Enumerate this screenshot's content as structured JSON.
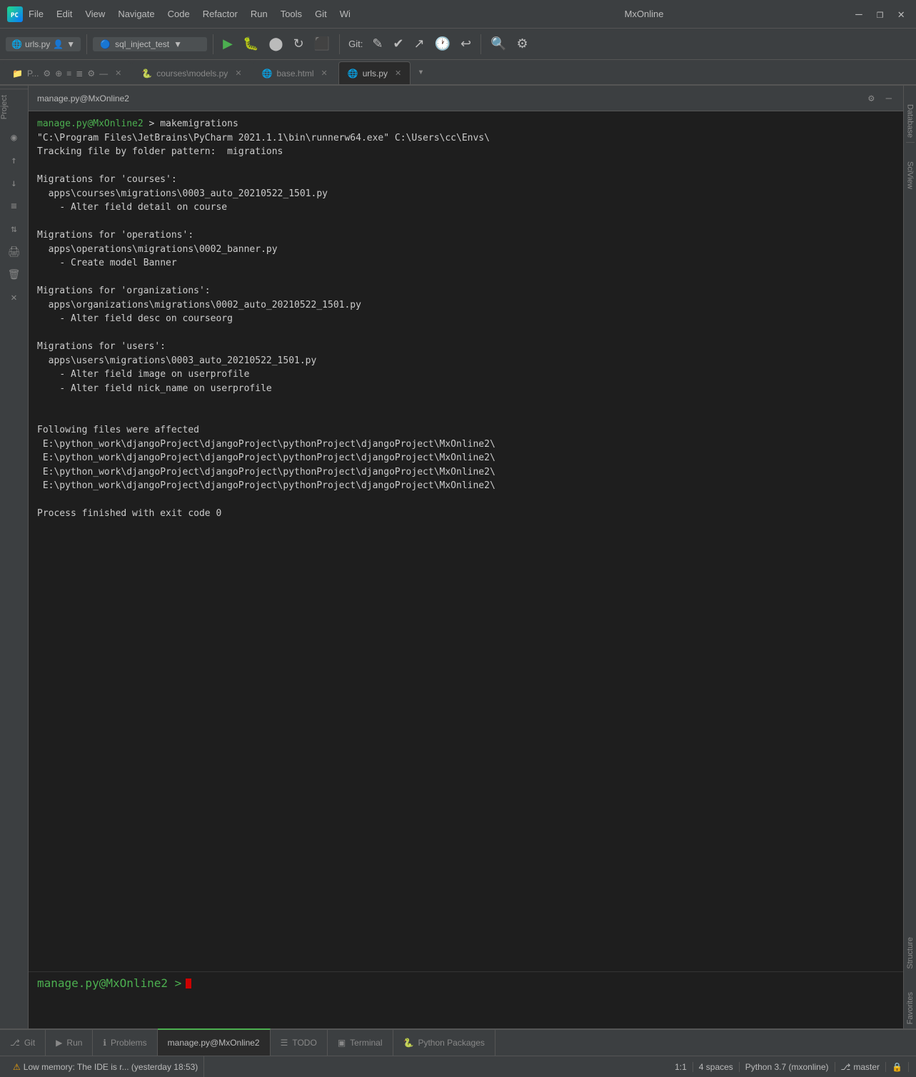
{
  "titlebar": {
    "menu_items": [
      "File",
      "Edit",
      "View",
      "Navigate",
      "Code",
      "Refactor",
      "Run",
      "Tools",
      "Git",
      "Wi"
    ],
    "title": "MxOnline",
    "controls": [
      "—",
      "❐",
      "✕"
    ]
  },
  "toolbar": {
    "file_label": "urls.py",
    "branch_label": "sql_inject_test",
    "git_label": "Git:",
    "search_icon": "🔍",
    "settings_icon": "⚙"
  },
  "tabs": [
    {
      "label": "P...",
      "icon": "📄",
      "active": false,
      "closable": false
    },
    {
      "label": "courses\\models.py",
      "icon": "🐍",
      "active": false,
      "closable": true
    },
    {
      "label": "base.html",
      "icon": "🌐",
      "active": false,
      "closable": true
    },
    {
      "label": "urls.py",
      "icon": "🌐",
      "active": true,
      "closable": true
    }
  ],
  "terminal": {
    "title": "manage.py@MxOnline2",
    "prompt": "manage.py@MxOnline2",
    "command": "makemigrations",
    "output": [
      "\"C:\\Program Files\\JetBrains\\PyCharm 2021.1.1\\bin\\runnerw64.exe\" C:\\Users\\cc\\Envs\\",
      "Tracking file by folder pattern:  migrations",
      "",
      "Migrations for 'courses':",
      "  apps\\courses\\migrations\\0003_auto_20210522_1501.py",
      "    - Alter field detail on course",
      "",
      "Migrations for 'operations':",
      "  apps\\operations\\migrations\\0002_banner.py",
      "    - Create model Banner",
      "",
      "Migrations for 'organizations':",
      "  apps\\organizations\\migrations\\0002_auto_20210522_1501.py",
      "    - Alter field desc on courseorg",
      "",
      "Migrations for 'users':",
      "  apps\\users\\migrations\\0003_auto_20210522_1501.py",
      "    - Alter field image on userprofile",
      "    - Alter field nick_name on userprofile",
      "",
      "",
      "Following files were affected",
      " E:\\python_work\\djangoProject\\djangoProject\\pythonProject\\djangoProject\\MxOnline2\\",
      " E:\\python_work\\djangoProject\\djangoProject\\pythonProject\\djangoProject\\MxOnline2\\",
      " E:\\python_work\\djangoProject\\djangoProject\\pythonProject\\djangoProject\\MxOnline2\\",
      " E:\\python_work\\djangoProject\\djangoProject\\pythonProject\\djangoProject\\MxOnline2\\",
      "",
      "Process finished with exit code 0"
    ],
    "input_prompt": "manage.py@MxOnline2 >"
  },
  "bottom_tabs": [
    {
      "label": "Git",
      "icon": "⎇",
      "active": false
    },
    {
      "label": "Run",
      "icon": "▶",
      "active": false
    },
    {
      "label": "Problems",
      "icon": "ℹ",
      "active": false
    },
    {
      "label": "manage.py@MxOnline2",
      "icon": "",
      "active": true
    },
    {
      "label": "TODO",
      "icon": "☰",
      "active": false
    },
    {
      "label": "Terminal",
      "icon": "▣",
      "active": false
    },
    {
      "label": "Python Packages",
      "icon": "🐍",
      "active": false
    }
  ],
  "status_bar": {
    "warning": "Low memory: The IDE is r... (yesterday 18:53)",
    "position": "1:1",
    "indent": "4 spaces",
    "python": "Python 3.7 (mxonline)",
    "branch": "master",
    "lock": "🔒"
  },
  "left_panel": {
    "label": "Project"
  },
  "right_panels": {
    "database": "Database",
    "sciview": "SciView"
  },
  "side_panels": {
    "structure": "Structure",
    "favorites": "Favorites"
  }
}
